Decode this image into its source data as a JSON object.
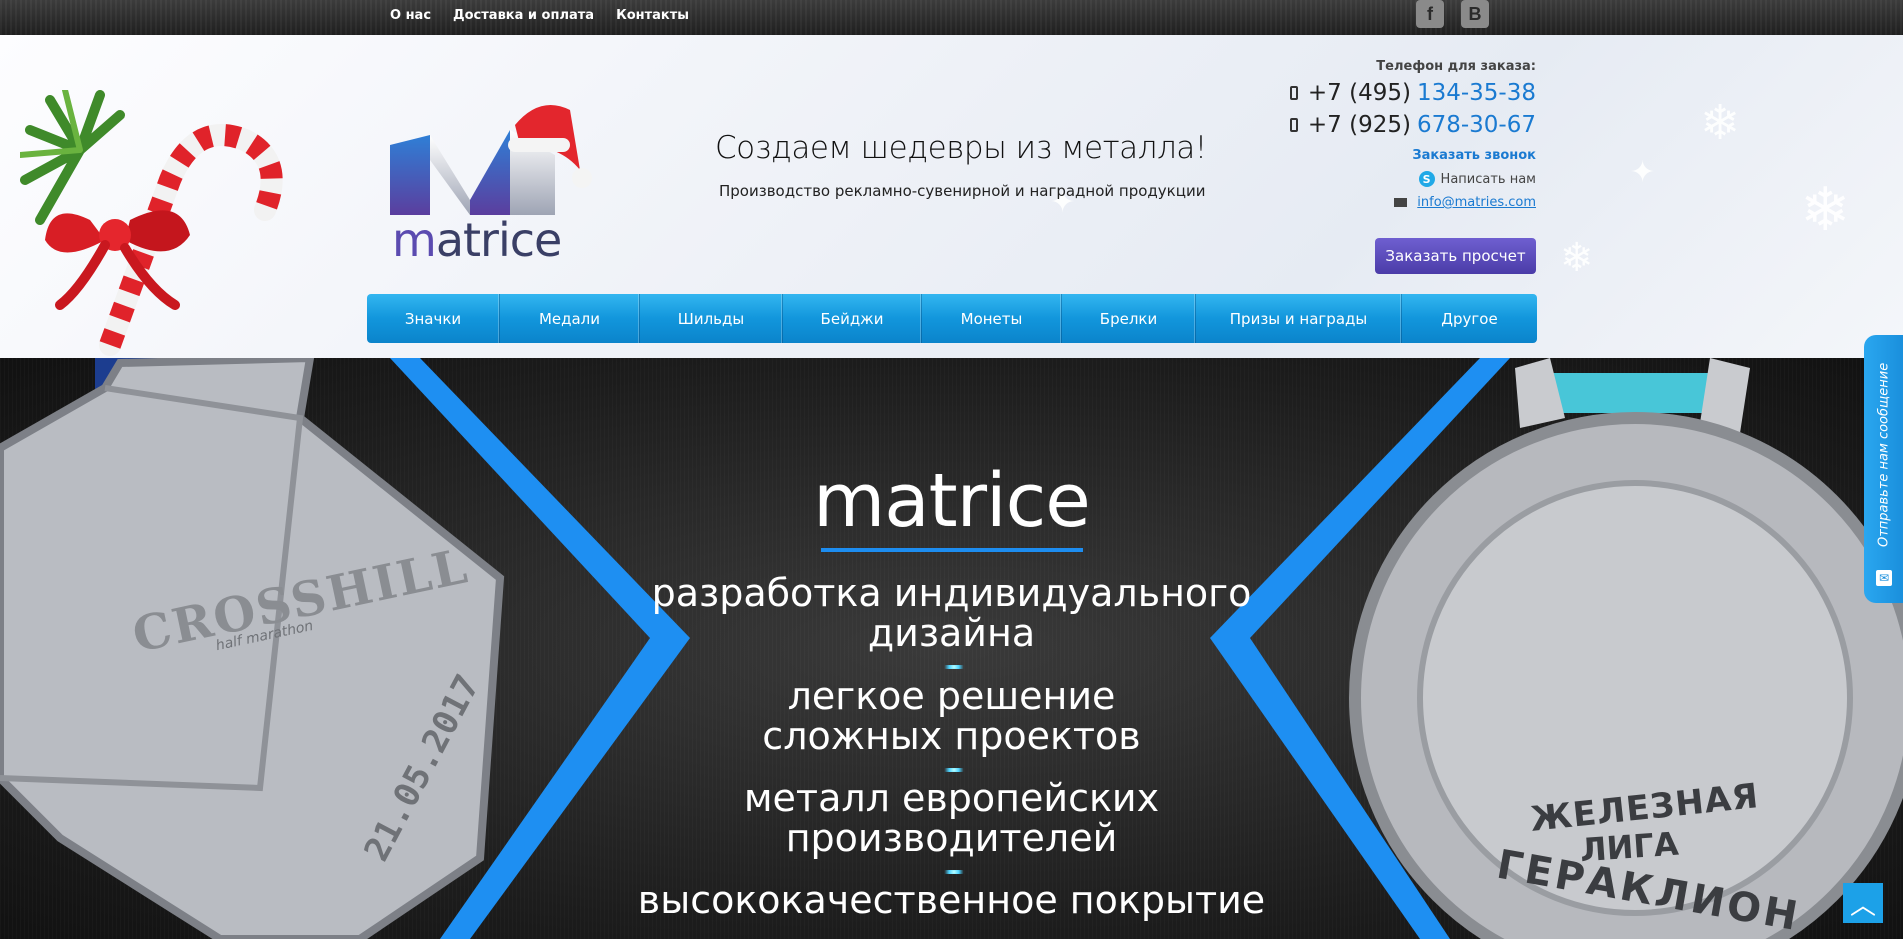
{
  "topbar": {
    "nav": [
      "О нас",
      "Доставка и оплата",
      "Контакты"
    ],
    "social": {
      "facebook_label": "f",
      "vk_label": "B"
    }
  },
  "header": {
    "logo_text_prefix": "m",
    "logo_text_rest": "atrice",
    "tagline": "Создаем шедевры из металла!",
    "subtagline": "Производство рекламно-сувенирной и наградной продукции",
    "contacts": {
      "phone_caption": "Телефон для заказа:",
      "phone1_code": "+7 (495)",
      "phone1_number": "134-35-38",
      "phone2_code": "+7 (925)",
      "phone2_number": "678-30-67",
      "callback": "Заказать звонок",
      "skype": "Написать нам",
      "email": "info@matries.com"
    },
    "order_button": "Заказать просчет"
  },
  "menu": [
    "Значки",
    "Медали",
    "Шильды",
    "Бейджи",
    "Монеты",
    "Брелки",
    "Призы и награды",
    "Другое"
  ],
  "banner": {
    "logo": "matrice",
    "line1a": "разработка индивидуального",
    "line1b": "дизайна",
    "line2a": "легкое решение",
    "line2b": "сложных проектов",
    "line3a": "металл европейских",
    "line3b": "производителей",
    "line4": "высококачественное покрытие",
    "left_medal_name": "CROSSHILL",
    "left_medal_sub": "half marathon",
    "left_medal_date": "21.05.2017",
    "right_medal_line1": "ЖЕЛЕЗНАЯ",
    "right_medal_line2": "ЛИГА",
    "right_medal_line3": "ГЕРАКЛИОН"
  },
  "feedback": {
    "label": "Отправьте нам сообщение"
  },
  "colors": {
    "accent": "#1a8fdc",
    "menu": "#1296dc",
    "order_button": "#5a4bbd"
  }
}
